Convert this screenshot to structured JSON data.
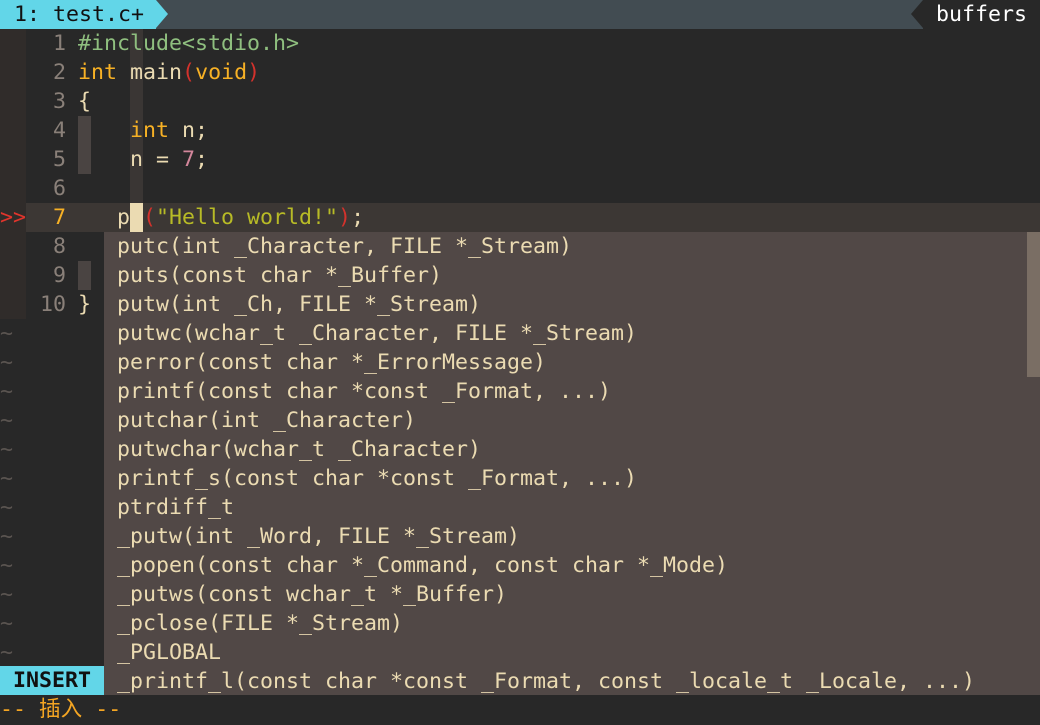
{
  "tabline": {
    "active_tab": "1: test.c+",
    "right_label": "buffers"
  },
  "editor": {
    "lines": [
      {
        "n": "1",
        "segs": [
          [
            "pp",
            "#include<stdio.h>"
          ]
        ]
      },
      {
        "n": "2",
        "segs": [
          [
            "kw",
            "int"
          ],
          [
            "",
            "main"
          ],
          [
            "par",
            "("
          ],
          [
            "kw",
            "void"
          ],
          [
            "par",
            ")"
          ]
        ]
      },
      {
        "n": "3",
        "segs": [
          [
            "",
            "{"
          ]
        ]
      },
      {
        "n": "4",
        "segs": [
          [
            "",
            "    "
          ],
          [
            "kw",
            "int"
          ],
          [
            "",
            "",
            " n;"
          ]
        ]
      },
      {
        "n": "5",
        "segs": [
          [
            "",
            "    n = "
          ],
          [
            "num",
            "7"
          ],
          [
            "",
            ";"
          ]
        ]
      },
      {
        "n": "6",
        "segs": []
      },
      {
        "n": "7",
        "segs": [
          [
            "",
            "   p "
          ],
          [
            "par",
            "("
          ],
          [
            "str",
            "\"Hello world!\""
          ],
          [
            "par",
            ")"
          ],
          [
            "",
            ";"
          ]
        ]
      },
      {
        "n": "8",
        "segs": []
      },
      {
        "n": "9",
        "segs": []
      },
      {
        "n": "10",
        "segs": [
          [
            "",
            "}"
          ]
        ]
      }
    ],
    "current_line": "7",
    "sign_marker": ">>",
    "tilde": "~"
  },
  "popup": {
    "items": [
      "putc(int _Character, FILE *_Stream)",
      "puts(const char *_Buffer)",
      "putw(int _Ch, FILE *_Stream)",
      "putwc(wchar_t _Character, FILE *_Stream)",
      "perror(const char *_ErrorMessage)",
      "printf(const char *const _Format, ...)",
      "putchar(int _Character)",
      "putwchar(wchar_t _Character)",
      "printf_s(const char *const _Format, ...)",
      "ptrdiff_t",
      "_putw(int _Word, FILE *_Stream)",
      "_popen(const char *_Command, const char *_Mode)",
      "_putws(const wchar_t *_Buffer)",
      "_pclose(FILE *_Stream)",
      "_PGLOBAL",
      "_printf_l(const char *const _Format, const _locale_t _Locale, ...)"
    ]
  },
  "statusline": {
    "mode": "INSERT"
  },
  "cmdline": {
    "text": "-- 插入 --"
  },
  "colors": {
    "accent": "#62d6e8",
    "popup_bg": "#514846",
    "keyword": "#f7b125",
    "string": "#b8bb26",
    "cmdline": "#f5a623"
  }
}
